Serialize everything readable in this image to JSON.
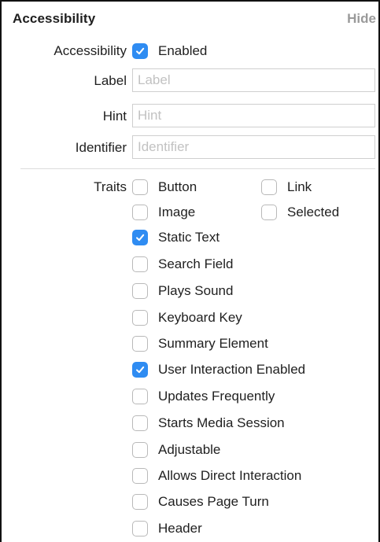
{
  "section": {
    "title": "Accessibility",
    "hide_label": "Hide"
  },
  "accessibility": {
    "label": "Accessibility",
    "checkbox_label": "Enabled",
    "checked": true
  },
  "fields": [
    {
      "label": "Label",
      "value": "",
      "placeholder": "Label"
    },
    {
      "label": "Hint",
      "value": "",
      "placeholder": "Hint"
    },
    {
      "label": "Identifier",
      "value": "",
      "placeholder": "Identifier"
    }
  ],
  "traits": {
    "label": "Traits",
    "items": [
      {
        "label": "Button",
        "checked": false
      },
      {
        "label": "Link",
        "checked": false
      },
      {
        "label": "Image",
        "checked": false
      },
      {
        "label": "Selected",
        "checked": false
      },
      {
        "label": "Static Text",
        "checked": true
      },
      {
        "label": "Search Field",
        "checked": false
      },
      {
        "label": "Plays Sound",
        "checked": false
      },
      {
        "label": "Keyboard Key",
        "checked": false
      },
      {
        "label": "Summary Element",
        "checked": false
      },
      {
        "label": "User Interaction Enabled",
        "checked": true
      },
      {
        "label": "Updates Frequently",
        "checked": false
      },
      {
        "label": "Starts Media Session",
        "checked": false
      },
      {
        "label": "Adjustable",
        "checked": false
      },
      {
        "label": "Allows Direct Interaction",
        "checked": false
      },
      {
        "label": "Causes Page Turn",
        "checked": false
      },
      {
        "label": "Header",
        "checked": false
      }
    ]
  },
  "colors": {
    "accent": "#2f8cf2",
    "text": "#1f1f1f",
    "muted": "#9a9a9a",
    "placeholder": "#c2c2c2",
    "field_border": "#cfcfcf",
    "divider": "#dcdcdc"
  }
}
